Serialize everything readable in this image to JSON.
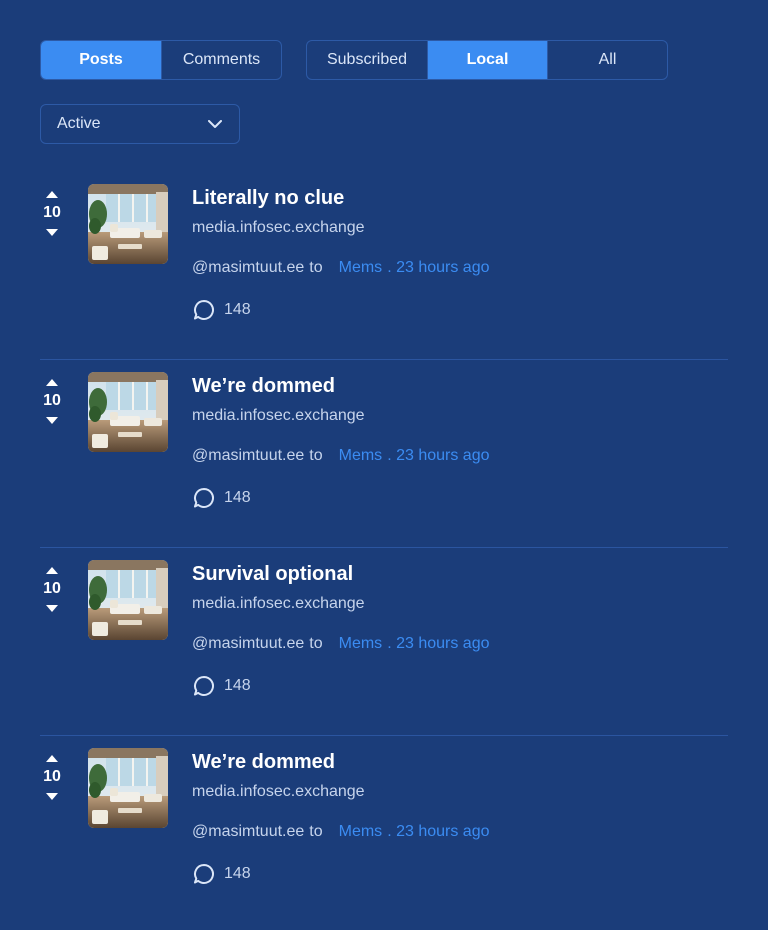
{
  "tabs_type": [
    {
      "label": "Posts",
      "active": true
    },
    {
      "label": "Comments",
      "active": false
    }
  ],
  "tabs_listing": [
    {
      "label": "Subscribed",
      "active": false
    },
    {
      "label": "Local",
      "active": true
    },
    {
      "label": "All",
      "active": false
    }
  ],
  "sort": {
    "value": "Active",
    "icon": "chevron-down-icon"
  },
  "posts": [
    {
      "votes": "10",
      "title": "Literally no clue",
      "domain": "media.infosec.exchange",
      "user": "@masimtuut.ee",
      "to_label": "to",
      "community": "Mems",
      "time": ". 23 hours ago",
      "comments": "148"
    },
    {
      "votes": "10",
      "title": "We’re dommed",
      "domain": "media.infosec.exchange",
      "user": "@masimtuut.ee",
      "to_label": "to",
      "community": "Mems",
      "time": ". 23 hours ago",
      "comments": "148"
    },
    {
      "votes": "10",
      "title": "Survival optional",
      "domain": "media.infosec.exchange",
      "user": "@masimtuut.ee",
      "to_label": "to",
      "community": "Mems",
      "time": ". 23 hours ago",
      "comments": "148"
    },
    {
      "votes": "10",
      "title": "We’re dommed",
      "domain": "media.infosec.exchange",
      "user": "@masimtuut.ee",
      "to_label": "to",
      "community": "Mems",
      "time": ". 23 hours ago",
      "comments": "148"
    }
  ],
  "colors": {
    "background": "#1b3d7a",
    "accent": "#3b8cf2",
    "border": "#2d5aa6"
  },
  "icons": {
    "upvote": "upvote-arrow-icon",
    "downvote": "downvote-arrow-icon",
    "comment": "comment-bubble-icon"
  }
}
